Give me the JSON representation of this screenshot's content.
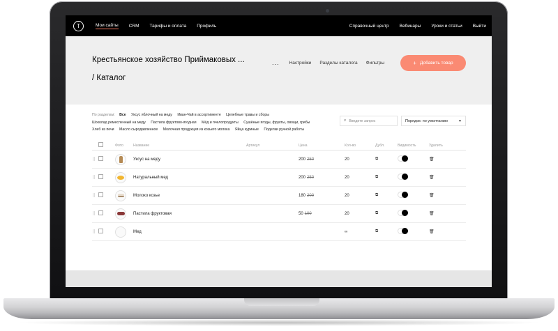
{
  "nav": {
    "logo": "T",
    "left": [
      "Мои сайты",
      "CRM",
      "Тарифы и оплата",
      "Профиль"
    ],
    "right": [
      "Справочный центр",
      "Вебинары",
      "Уроки и статьи",
      "Выйти"
    ]
  },
  "header": {
    "title": "Крестьянское хозяйство Приймаковых ... / Каталог",
    "more": "...",
    "links": [
      "Настройки",
      "Разделы каталога",
      "Фильтры"
    ],
    "add_button": "Добавить товар"
  },
  "filters": {
    "label": "По разделам:",
    "items": [
      "Все",
      "Уксус яблочный на меду",
      "Иван-Чай в ассортименте",
      "Целебные травы и сборы",
      "Шоколад ремесленный на меду",
      "Пастила фруктово-ягодная",
      "Мёд и пчелопродукты",
      "Сушёные ягоды, фрукты, овощи, грибы",
      "Хлеб из печи",
      "Масло сыродавленное",
      "Молочная продукция из козьего молока",
      "Яйца куриные",
      "Поделки ручной работы"
    ]
  },
  "search": {
    "placeholder": "Введите запрос"
  },
  "sort": {
    "value": "Порядок: по умолчанию"
  },
  "table": {
    "headers": {
      "photo": "Фото",
      "name": "Название",
      "art": "Артикул",
      "price": "Цена",
      "qty": "Кол-во",
      "dup": "Дубл.",
      "vis": "Видимость",
      "del": "Удалить"
    },
    "rows": [
      {
        "name": "Уксус на меду",
        "price": "200",
        "old": "250",
        "qty": "20",
        "thumb": "bottle"
      },
      {
        "name": "Натуральный мед",
        "price": "200",
        "old": "250",
        "qty": "20",
        "thumb": "honey"
      },
      {
        "name": "Молоко козье",
        "price": "180",
        "old": "200",
        "qty": "20",
        "thumb": "milk"
      },
      {
        "name": "Пастила фруктовая",
        "price": "50",
        "old": "100",
        "qty": "20",
        "thumb": "pastila"
      },
      {
        "name": "Мед",
        "price": "",
        "old": "",
        "qty": "∞",
        "thumb": ""
      }
    ]
  }
}
